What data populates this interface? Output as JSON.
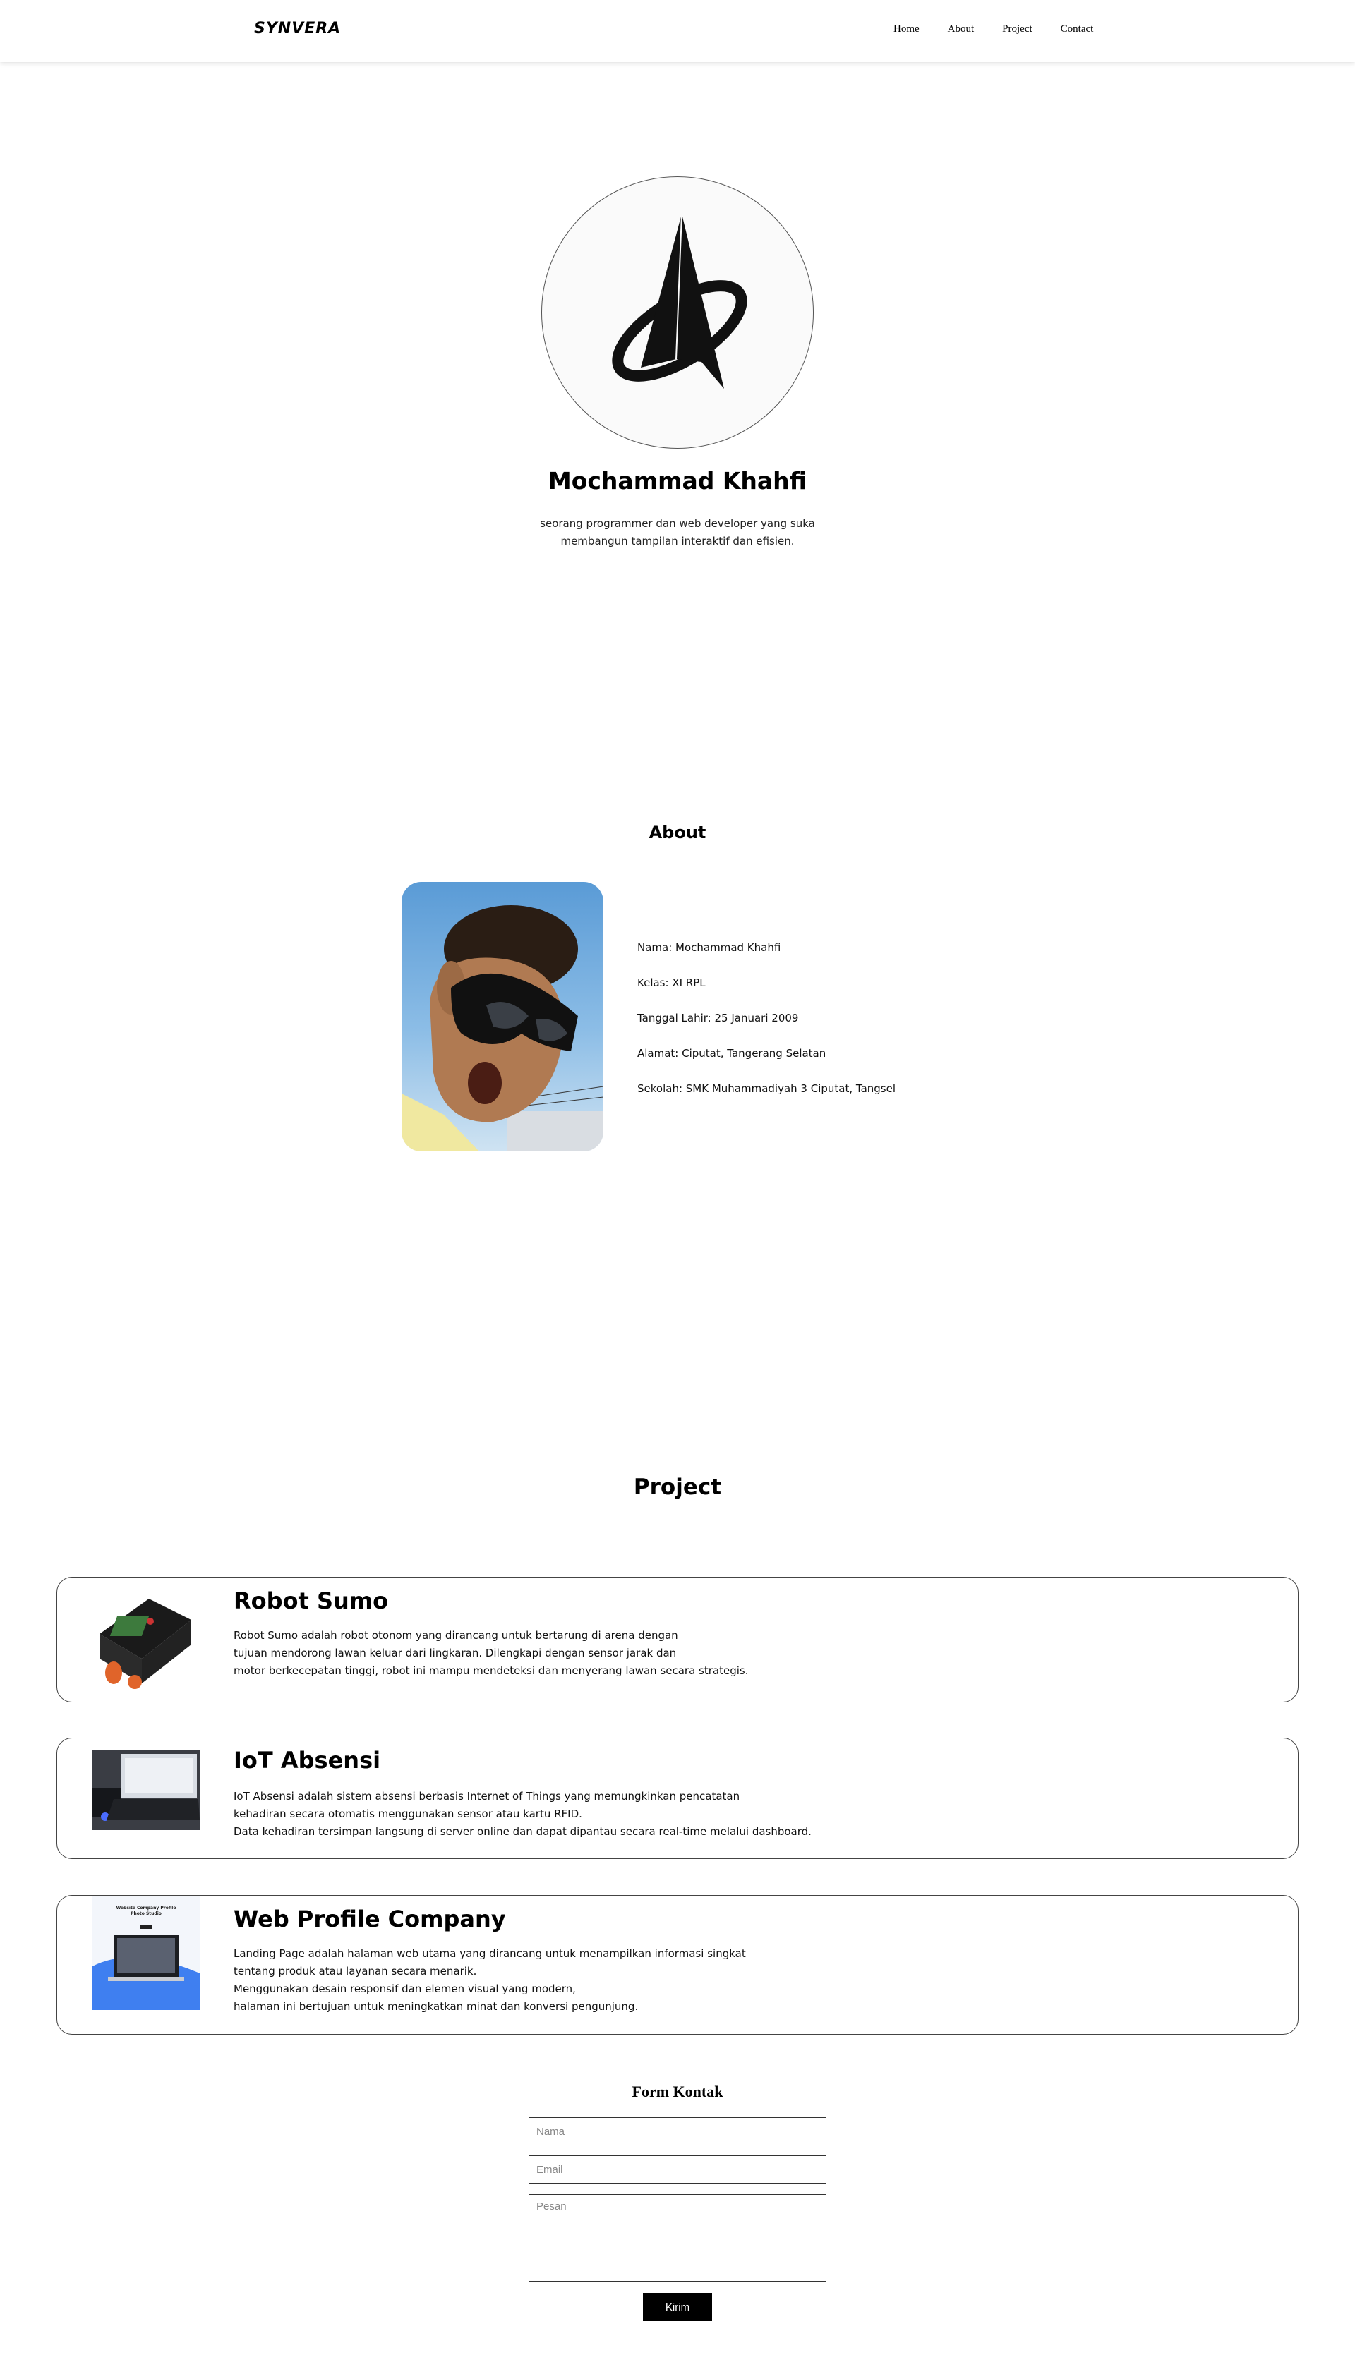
{
  "navbar": {
    "brand": "SYNVERA",
    "links": [
      "Home",
      "About",
      "Project",
      "Contact"
    ]
  },
  "hero": {
    "name": "Mochammad Khahfi",
    "description_line1": "seorang programmer dan web developer yang suka",
    "description_line2": "membangun tampilan interaktif dan efisien."
  },
  "about": {
    "title": "About",
    "info": [
      "Nama: Mochammad Khahfi",
      "Kelas: XI RPL",
      "Tanggal Lahir: 25 Januari 2009",
      "Alamat: Ciputat, Tangerang Selatan",
      "Sekolah: SMK Muhammadiyah 3 Ciputat, Tangsel"
    ]
  },
  "project": {
    "title": "Project",
    "items": [
      {
        "title": "Robot Sumo",
        "lines": [
          "Robot Sumo adalah robot otonom yang dirancang untuk bertarung di arena dengan",
          "tujuan mendorong lawan keluar dari lingkaran. Dilengkapi dengan sensor jarak dan",
          "motor berkecepatan tinggi, robot ini mampu mendeteksi dan menyerang lawan secara strategis."
        ]
      },
      {
        "title": "IoT Absensi",
        "lines": [
          "IoT Absensi adalah sistem absensi berbasis Internet of Things yang memungkinkan pencatatan",
          "kehadiran secara otomatis menggunakan sensor atau kartu RFID.",
          "Data kehadiran tersimpan langsung di server online dan dapat dipantau secara real-time melalui dashboard."
        ]
      },
      {
        "title": "Web Profile Company",
        "lines": [
          "Landing Page adalah halaman web utama yang dirancang untuk menampilkan informasi singkat",
          "tentang produk atau layanan secara menarik.",
          "Menggunakan desain responsif dan elemen visual yang modern,",
          "halaman ini bertujuan untuk meningkatkan minat dan konversi pengunjung."
        ]
      }
    ]
  },
  "contact": {
    "title": "Form Kontak",
    "name_placeholder": "Nama",
    "email_placeholder": "Email",
    "message_placeholder": "Pesan",
    "submit_label": "Kirim"
  },
  "thumbnails": {
    "web_profile_title": "Website Company Profile",
    "web_profile_subtitle": "Photo Studio"
  }
}
